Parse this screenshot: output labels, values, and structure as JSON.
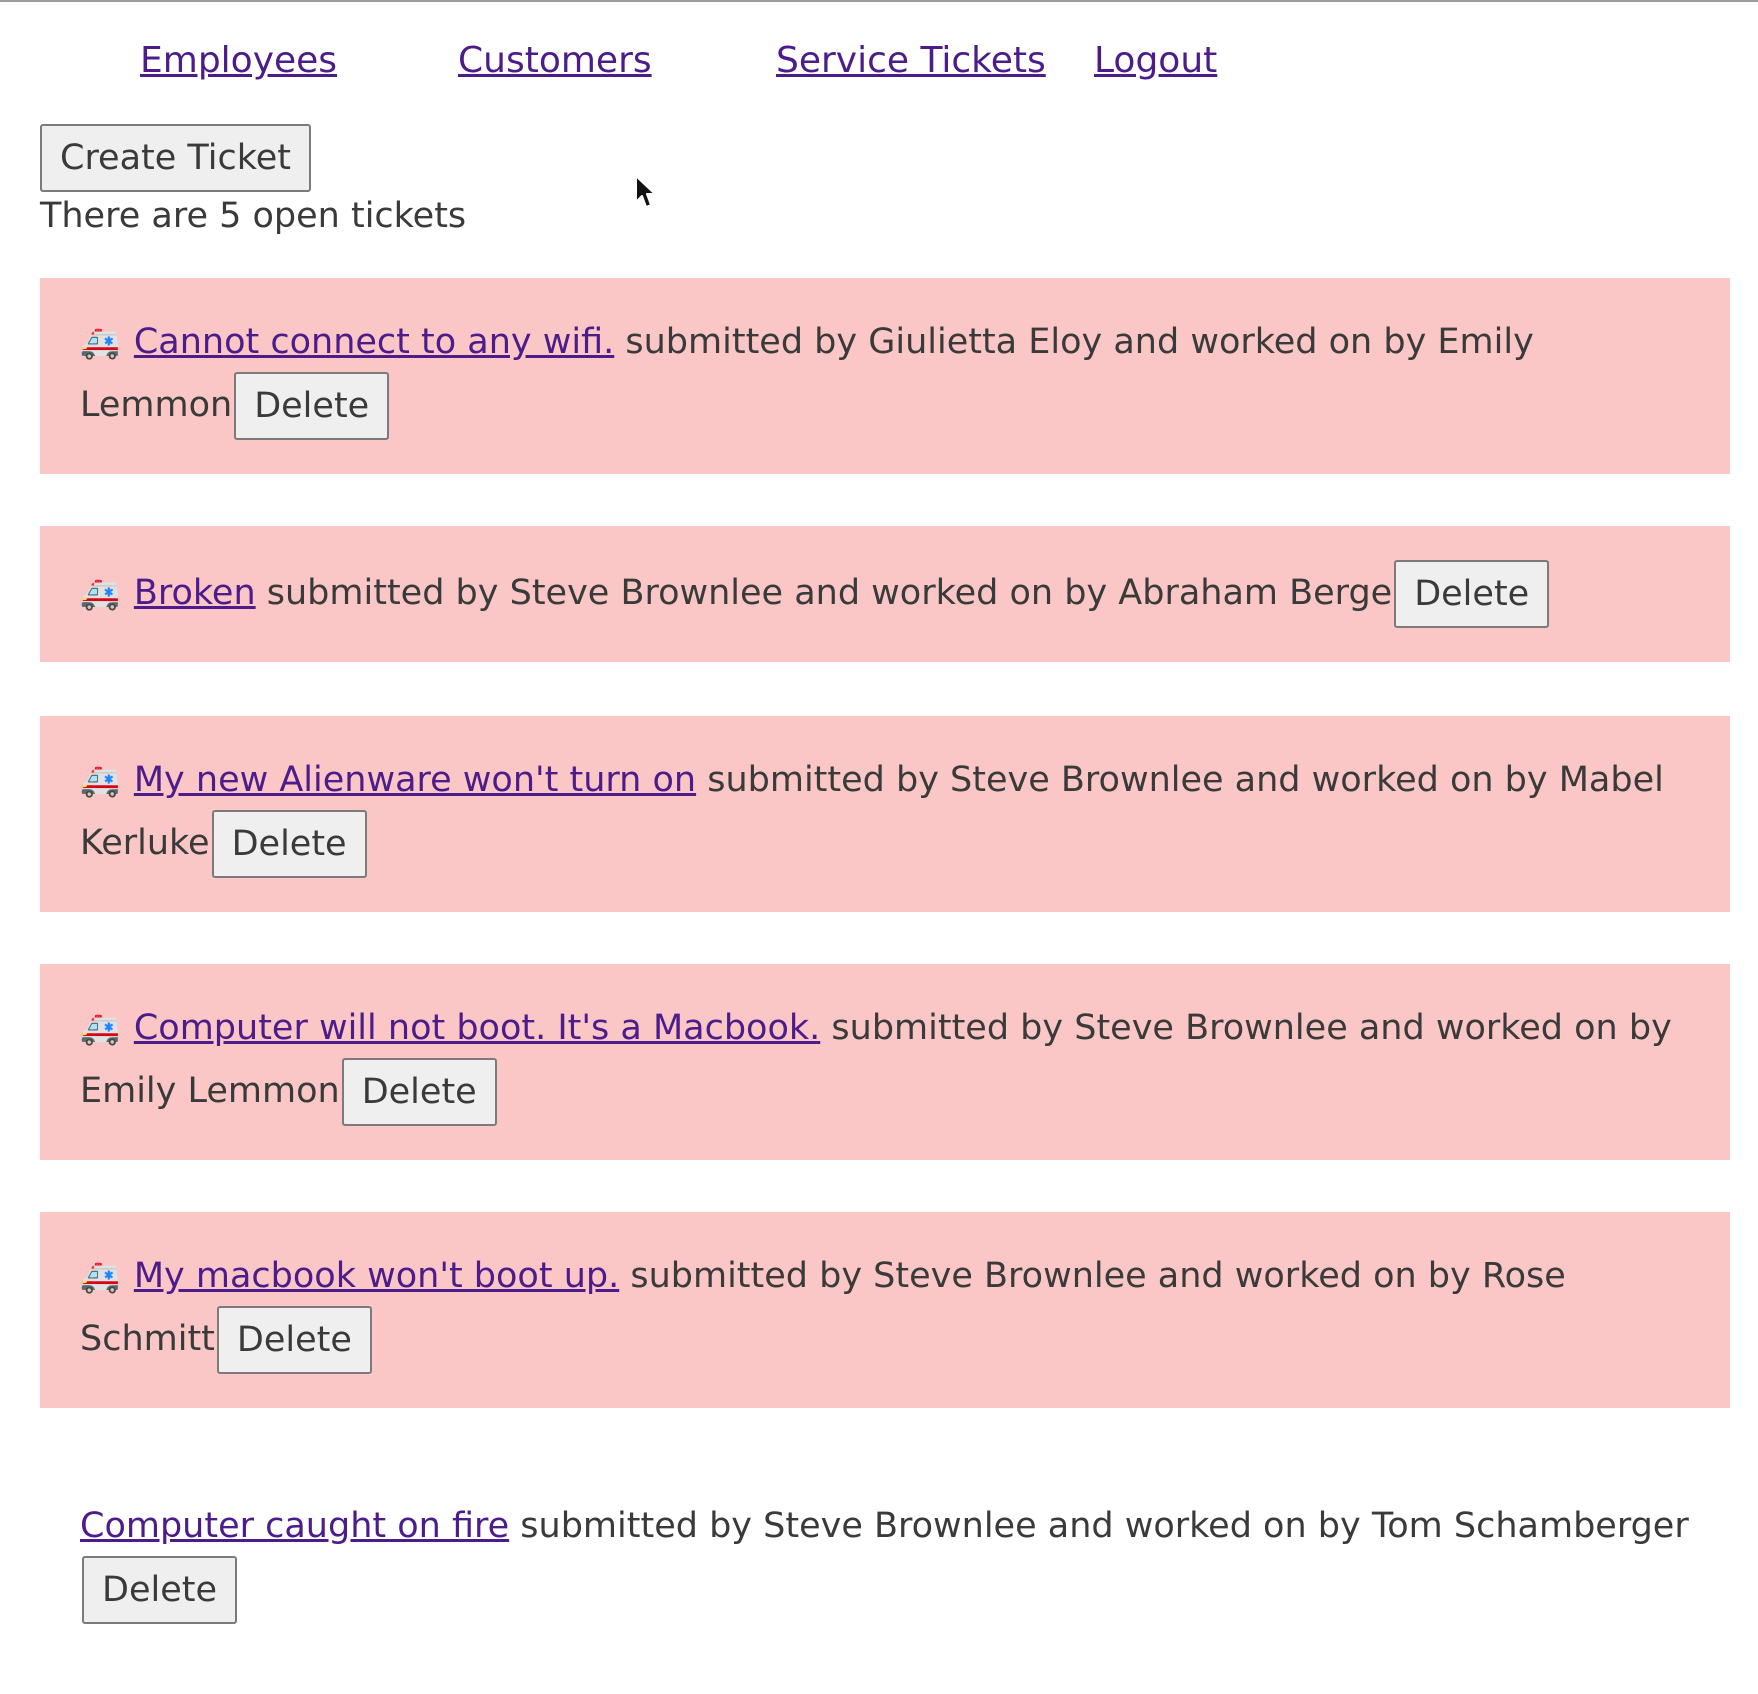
{
  "nav": {
    "employees": "Employees",
    "customers": "Customers",
    "service_tickets": "Service Tickets",
    "logout": "Logout"
  },
  "create_ticket_label": "Create Ticket",
  "open_count_text": "There are 5 open tickets",
  "delete_label": "Delete",
  "emergency_icon": "🚑",
  "icons": {
    "emergency": "ambulance-icon",
    "cursor": "mouse-cursor-icon"
  },
  "colors": {
    "emergency_bg": "#fac6c6",
    "link": "#4b1c8a",
    "text": "#3a3a3a"
  },
  "tickets": [
    {
      "emergency": true,
      "description": "Cannot connect to any wifi.",
      "details": " submitted by Giulietta Eloy and worked on by Emily Lemmon"
    },
    {
      "emergency": true,
      "description": "Broken",
      "details": " submitted by Steve Brownlee and worked on by Abraham Berge"
    },
    {
      "emergency": true,
      "description": "My new Alienware won't turn on",
      "details": " submitted by Steve Brownlee and worked on by Mabel Kerluke"
    },
    {
      "emergency": true,
      "description": "Computer will not boot. It's a Macbook.",
      "details": " submitted by Steve Brownlee and worked on by Emily Lemmon"
    },
    {
      "emergency": true,
      "description": "My macbook won't boot up.",
      "details": " submitted by Steve Brownlee and worked on by Rose Schmitt"
    },
    {
      "emergency": false,
      "description": "Computer caught on fire",
      "details": " submitted by Steve Brownlee and worked on by Tom Schamberger"
    }
  ]
}
